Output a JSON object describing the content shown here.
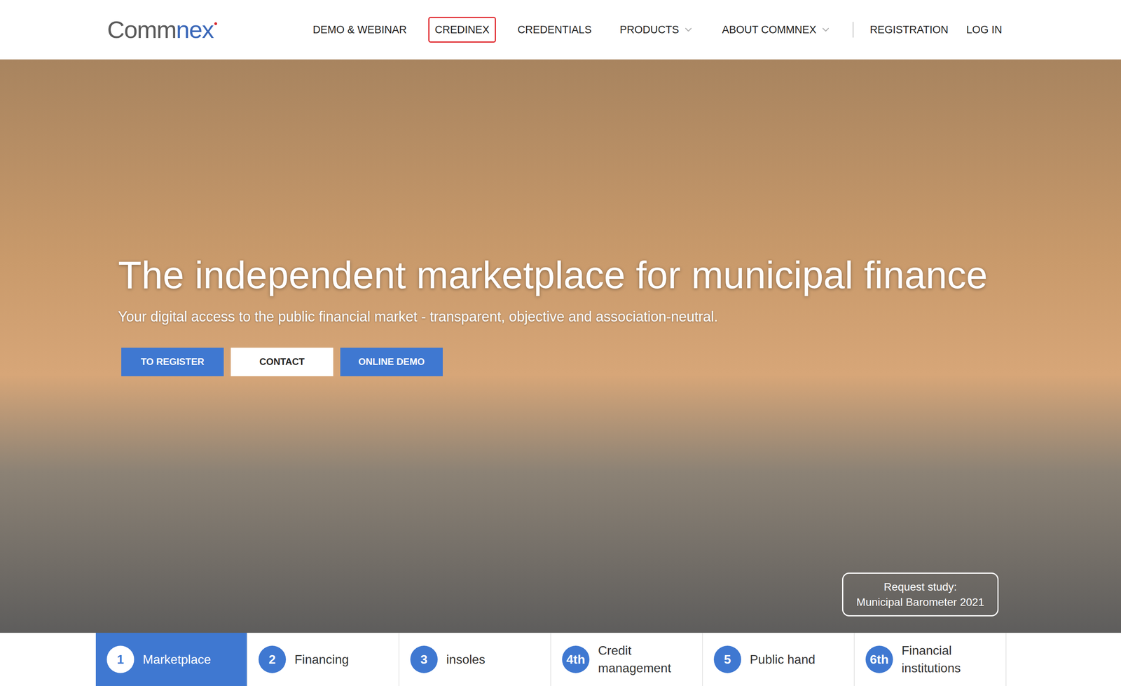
{
  "logo": {
    "dark": "Comm",
    "accent": "nex"
  },
  "nav": [
    {
      "label": "DEMO & WEBINAR",
      "highlighted": false,
      "dropdown": false
    },
    {
      "label": "CREDINEX",
      "highlighted": true,
      "dropdown": false
    },
    {
      "label": "CREDENTIALS",
      "highlighted": false,
      "dropdown": false
    },
    {
      "label": "PRODUCTS",
      "highlighted": false,
      "dropdown": true
    },
    {
      "label": "ABOUT COMMNEX",
      "highlighted": false,
      "dropdown": true
    }
  ],
  "account_links": [
    "REGISTRATION",
    "LOG IN"
  ],
  "hero": {
    "title": "The independent marketplace for municipal finance",
    "subtitle": "Your digital access to the public financial market - transparent, objective and association-neutral.",
    "buttons": [
      {
        "label": "TO REGISTER",
        "kind": "primary"
      },
      {
        "label": "CONTACT",
        "kind": "light"
      },
      {
        "label": "ONLINE DEMO",
        "kind": "primary"
      }
    ],
    "study": {
      "line1": "Request study:",
      "line2": "Municipal Barometer 2021"
    }
  },
  "tabs": [
    {
      "number": "1",
      "label": "Marketplace",
      "selected": true
    },
    {
      "number": "2",
      "label": "Financing",
      "selected": false
    },
    {
      "number": "3",
      "label": "insoles",
      "selected": false
    },
    {
      "number": "4th",
      "label": "Credit management",
      "selected": false
    },
    {
      "number": "5",
      "label": "Public hand",
      "selected": false
    },
    {
      "number": "6th",
      "label": "Financial institutions",
      "selected": false
    }
  ]
}
